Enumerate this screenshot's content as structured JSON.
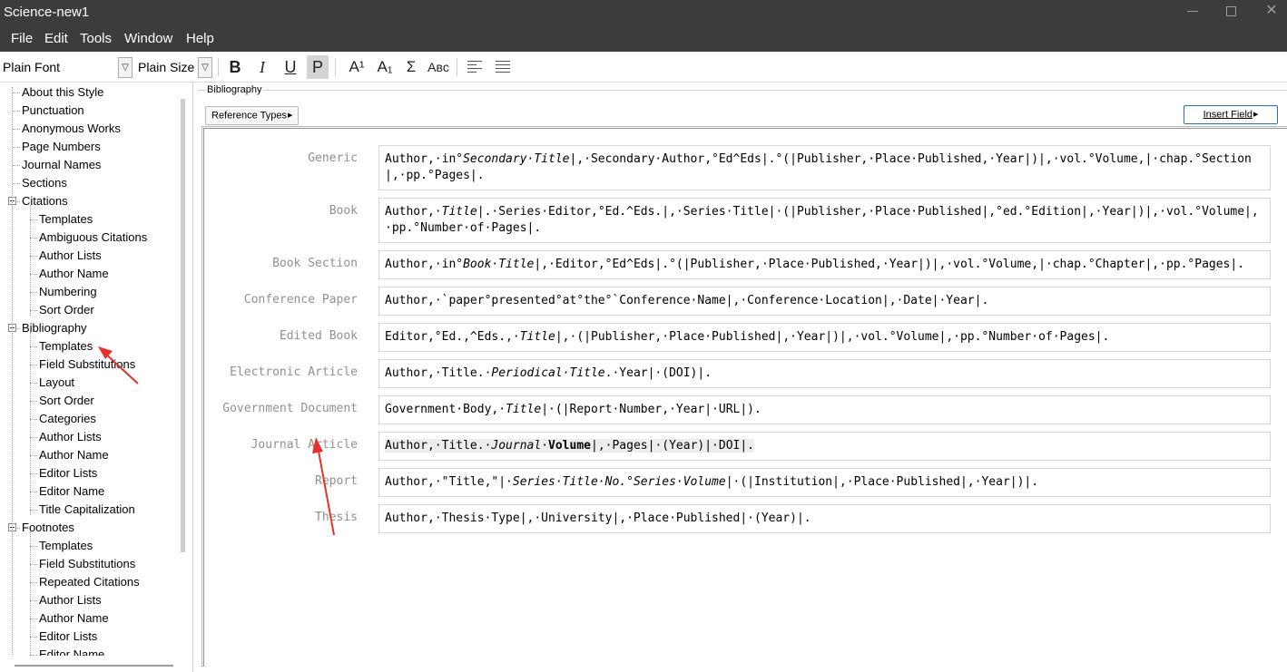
{
  "window": {
    "title": "Science-new1"
  },
  "menu": [
    "File",
    "Edit",
    "Tools",
    "Window",
    "Help"
  ],
  "toolbar": {
    "font": "Plain Font",
    "size": "Plain Size",
    "bold": "B",
    "italic": "I",
    "underline": "U",
    "plain": "P",
    "superscript": "A¹",
    "subscript": "A₁",
    "symbol": "Σ",
    "smallcaps": "Aʙᴄ"
  },
  "tree": [
    {
      "label": "About this Style",
      "level": 0
    },
    {
      "label": "Punctuation",
      "level": 0
    },
    {
      "label": "Anonymous Works",
      "level": 0
    },
    {
      "label": "Page Numbers",
      "level": 0
    },
    {
      "label": "Journal Names",
      "level": 0
    },
    {
      "label": "Sections",
      "level": 0
    },
    {
      "label": "Citations",
      "level": 0,
      "expanded": true
    },
    {
      "label": "Templates",
      "level": 1
    },
    {
      "label": "Ambiguous Citations",
      "level": 1
    },
    {
      "label": "Author Lists",
      "level": 1
    },
    {
      "label": "Author Name",
      "level": 1
    },
    {
      "label": "Numbering",
      "level": 1
    },
    {
      "label": "Sort Order",
      "level": 1
    },
    {
      "label": "Bibliography",
      "level": 0,
      "expanded": true
    },
    {
      "label": "Templates",
      "level": 1,
      "selected": true
    },
    {
      "label": "Field Substitutions",
      "level": 1
    },
    {
      "label": "Layout",
      "level": 1
    },
    {
      "label": "Sort Order",
      "level": 1
    },
    {
      "label": "Categories",
      "level": 1
    },
    {
      "label": "Author Lists",
      "level": 1
    },
    {
      "label": "Author Name",
      "level": 1
    },
    {
      "label": "Editor Lists",
      "level": 1
    },
    {
      "label": "Editor Name",
      "level": 1
    },
    {
      "label": "Title Capitalization",
      "level": 1
    },
    {
      "label": "Footnotes",
      "level": 0,
      "expanded": true
    },
    {
      "label": "Templates",
      "level": 1
    },
    {
      "label": "Field Substitutions",
      "level": 1
    },
    {
      "label": "Repeated Citations",
      "level": 1
    },
    {
      "label": "Author Lists",
      "level": 1
    },
    {
      "label": "Author Name",
      "level": 1
    },
    {
      "label": "Editor Lists",
      "level": 1
    },
    {
      "label": "Editor Name",
      "level": 1
    }
  ],
  "main": {
    "group_label": "Bibliography",
    "reference_types_button": "Reference Types",
    "insert_field_button": "Insert Field",
    "templates": [
      {
        "type": "Generic",
        "parts": [
          [
            "n",
            "Author,·in°"
          ],
          [
            "i",
            "Secondary·Title"
          ],
          [
            "n",
            "|,·Secondary·Author,°Ed^Eds|.°(|Publisher,·Place·Published,·Year|)|,·vol.°Volume,|·chap.°Section|,·pp.°Pages|."
          ]
        ]
      },
      {
        "type": "Book",
        "parts": [
          [
            "n",
            "Author,·"
          ],
          [
            "i",
            "Title"
          ],
          [
            "n",
            "|.·Series·Editor,°Ed.^Eds.|,·Series·Title|·(|Publisher,·Place·Published|,°ed.°Edition|,·Year|)|,·vol.°Volume|,·pp.°Number·of·Pages|."
          ]
        ]
      },
      {
        "type": "Book Section",
        "parts": [
          [
            "n",
            "Author,·in°"
          ],
          [
            "i",
            "Book·Title"
          ],
          [
            "n",
            "|,·Editor,°Ed^Eds|.°(|Publisher,·Place·Published,·Year|)|,·vol.°Volume,|·chap.°Chapter|,·pp.°Pages|."
          ]
        ]
      },
      {
        "type": "Conference Paper",
        "parts": [
          [
            "n",
            "Author,·`paper°presented°at°the°`Conference·Name|,·Conference·Location|,·Date|·Year|."
          ]
        ]
      },
      {
        "type": "Edited Book",
        "parts": [
          [
            "n",
            "Editor,°Ed.,^Eds.,·"
          ],
          [
            "i",
            "Title"
          ],
          [
            "n",
            "|,·(|Publisher,·Place·Published|,·Year|)|,·vol.°Volume|,·pp.°Number·of·Pages|."
          ]
        ]
      },
      {
        "type": "Electronic Article",
        "parts": [
          [
            "n",
            "Author,·Title.·"
          ],
          [
            "i",
            "Periodical·Title"
          ],
          [
            "n",
            ".·Year|·(DOI)|."
          ]
        ]
      },
      {
        "type": "Government Document",
        "parts": [
          [
            "n",
            "Government·Body,·"
          ],
          [
            "i",
            "Title"
          ],
          [
            "n",
            "|·(|Report·Number,·Year|·URL|)."
          ]
        ]
      },
      {
        "type": "Journal Article",
        "highlighted": true,
        "parts": [
          [
            "n",
            "Author,·Title.·"
          ],
          [
            "i",
            "Journal"
          ],
          [
            "n",
            "·"
          ],
          [
            "b",
            "Volume"
          ],
          [
            "n",
            "|,·Pages|·(Year)|·DOI|."
          ]
        ]
      },
      {
        "type": "Report",
        "parts": [
          [
            "n",
            "Author,·\"Title,\"|·"
          ],
          [
            "i",
            "Series·Title·No.°Series·Volume"
          ],
          [
            "n",
            "|·(|Institution|,·Place·Published|,·Year|)|."
          ]
        ]
      },
      {
        "type": "Thesis",
        "parts": [
          [
            "n",
            "Author,·Thesis·Type|,·University|,·Place·Published|·(Year)|."
          ]
        ]
      }
    ]
  },
  "colors": {
    "titlebar": "#3c3c3c",
    "annotation_arrow": "#e8302a",
    "insert_border": "#1f6fd1"
  }
}
